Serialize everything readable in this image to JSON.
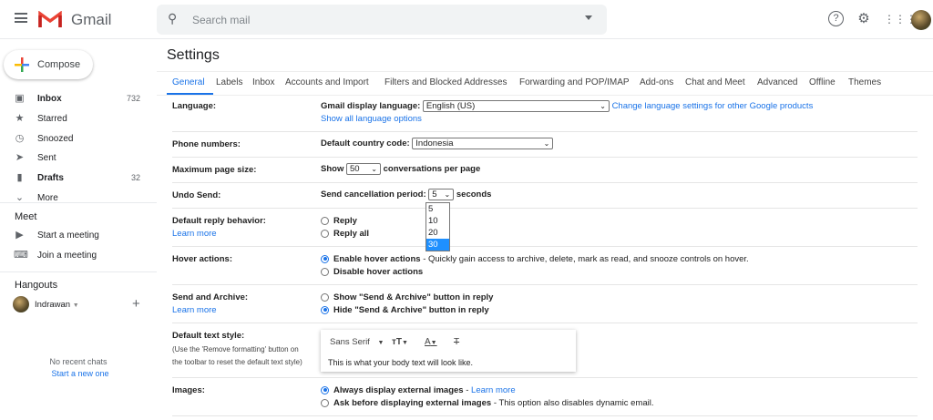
{
  "header": {
    "brand": "Gmail",
    "search_placeholder": "Search mail"
  },
  "sidebar": {
    "compose": "Compose",
    "items": [
      {
        "label": "Inbox",
        "count": "732"
      },
      {
        "label": "Starred",
        "count": ""
      },
      {
        "label": "Snoozed",
        "count": ""
      },
      {
        "label": "Sent",
        "count": ""
      },
      {
        "label": "Drafts",
        "count": "32"
      },
      {
        "label": "More",
        "count": ""
      }
    ],
    "meet": {
      "title": "Meet",
      "items": [
        "Start a meeting",
        "Join a meeting"
      ]
    },
    "hangouts": {
      "title": "Hangouts",
      "user": "Indrawan",
      "no_chats": "No recent chats",
      "start_chat": "Start a new one"
    }
  },
  "settings": {
    "title": "Settings",
    "tabs": [
      "General",
      "Labels",
      "Inbox",
      "Accounts and Import",
      "Filters and Blocked Addresses",
      "Forwarding and POP/IMAP",
      "Add-ons",
      "Chat and Meet",
      "Advanced",
      "Offline",
      "Themes"
    ],
    "language": {
      "label": "Language:",
      "field": "Gmail display language:",
      "value": "English (US)",
      "link": "Change language settings for other Google products",
      "show_all": "Show all language options"
    },
    "phone": {
      "label": "Phone numbers:",
      "field": "Default country code:",
      "value": "Indonesia"
    },
    "page_size": {
      "label": "Maximum page size:",
      "pre": "Show",
      "value": "50",
      "post": "conversations per page"
    },
    "undo": {
      "label": "Undo Send:",
      "field": "Send cancellation period:",
      "value": "5",
      "post": "seconds",
      "options": [
        "5",
        "10",
        "20",
        "30"
      ]
    },
    "reply": {
      "label": "Default reply behavior:",
      "learn": "Learn more",
      "options": [
        "Reply",
        "Reply all"
      ]
    },
    "hover": {
      "label": "Hover actions:",
      "enable": "Enable hover actions",
      "enable_desc": " - Quickly gain access to archive, delete, mark as read, and snooze controls on hover.",
      "disable": "Disable hover actions"
    },
    "send_archive": {
      "label": "Send and Archive:",
      "learn": "Learn more",
      "show": "Show \"Send & Archive\" button in reply",
      "hide": "Hide \"Send & Archive\" button in reply"
    },
    "text_style": {
      "label": "Default text style:",
      "hint1": "(Use the 'Remove formatting' button on",
      "hint2": "the toolbar to reset the default text style)",
      "font": "Sans Serif",
      "preview": "This is what your body text will look like."
    },
    "images": {
      "label": "Images:",
      "always": "Always display external images",
      "learn": "Learn more",
      "ask": "Ask before displaying external images",
      "ask_desc": " - This option also disables dynamic email."
    }
  }
}
